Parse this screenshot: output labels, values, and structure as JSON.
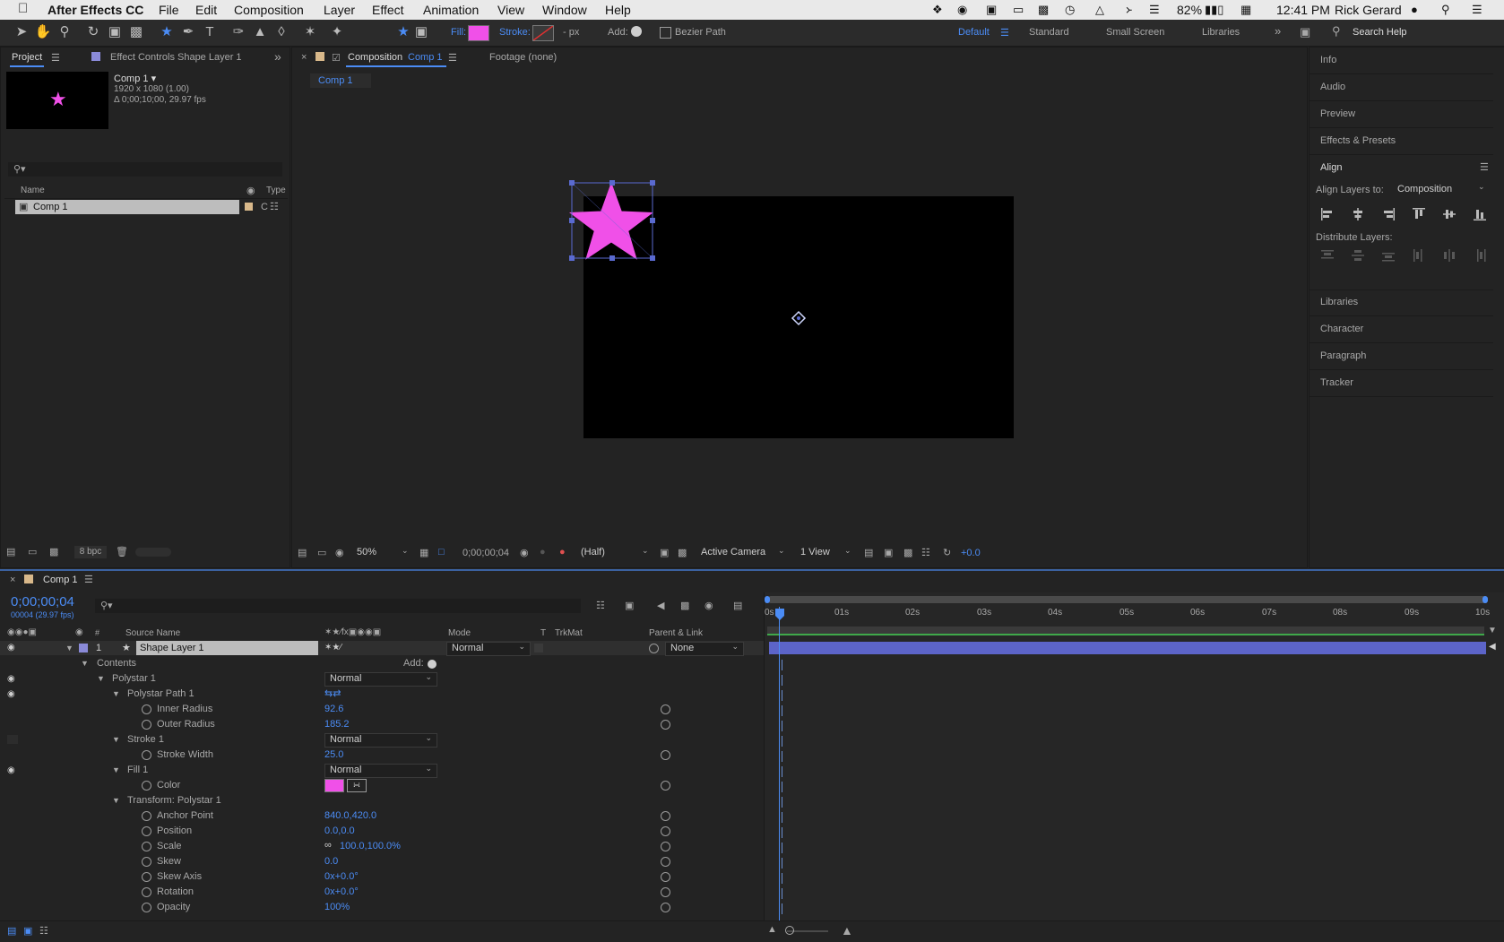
{
  "menubar": {
    "app_name": "After Effects CC",
    "items": [
      "File",
      "Edit",
      "Composition",
      "Layer",
      "Effect",
      "Animation",
      "View",
      "Window",
      "Help"
    ],
    "battery": "82%",
    "time": "12:41 PM",
    "user": "Rick Gerard"
  },
  "toolbar": {
    "fill_label": "Fill:",
    "fill_color": "#f050e8",
    "stroke_label": "Stroke:",
    "stroke_px": "- px",
    "add_label": "Add:",
    "bezier_label": "Bezier Path",
    "workspaces": [
      "Default",
      "Standard",
      "Small Screen",
      "Libraries"
    ],
    "search_help": "Search Help"
  },
  "project": {
    "tab_project": "Project",
    "tab_effect_controls": "Effect Controls Shape Layer 1",
    "comp_name": "Comp 1 ▾",
    "comp_res": "1920 x 1080 (1.00)",
    "comp_dur": "Δ 0;00;10;00, 29.97 fps",
    "col_name": "Name",
    "col_type": "Type",
    "item_name": "Comp 1",
    "item_type": "C",
    "bpc": "8 bpc"
  },
  "viewer": {
    "tab_composition": "Composition",
    "tab_comp_name": "Comp 1",
    "tab_footage": "Footage (none)",
    "breadcrumb": "Comp 1",
    "zoom": "50%",
    "timecode": "0;00;00;04",
    "resolution": "(Half)",
    "camera": "Active Camera",
    "views": "1 View",
    "exposure": "+0.0"
  },
  "right_panels": {
    "items": [
      "Info",
      "Audio",
      "Preview",
      "Effects & Presets"
    ],
    "align_title": "Align",
    "align_layers_to": "Align Layers to:",
    "align_target": "Composition",
    "distribute_layers": "Distribute Layers:",
    "items2": [
      "Libraries",
      "Character",
      "Paragraph",
      "Tracker"
    ]
  },
  "timeline": {
    "tab": "Comp 1",
    "timecode": "0;00;00;04",
    "frame_info": "00004 (29.97 fps)",
    "col_source": "Source Name",
    "col_mode": "Mode",
    "col_t": "T",
    "col_trkmat": "TrkMat",
    "col_parent": "Parent & Link",
    "ruler": [
      "0s",
      "01s",
      "02s",
      "03s",
      "04s",
      "05s",
      "06s",
      "07s",
      "08s",
      "09s",
      "10s"
    ],
    "layer": {
      "num": "1",
      "name": "Shape Layer 1",
      "mode": "Normal",
      "parent": "None"
    },
    "contents_label": "Contents",
    "add_label": "Add:",
    "polystar": "Polystar 1",
    "polystar_mode": "Normal",
    "polystar_path": "Polystar Path 1",
    "inner_radius_label": "Inner Radius",
    "inner_radius": "92.6",
    "outer_radius_label": "Outer Radius",
    "outer_radius": "185.2",
    "stroke": "Stroke 1",
    "stroke_mode": "Normal",
    "stroke_width_label": "Stroke Width",
    "stroke_width": "25.0",
    "fill": "Fill 1",
    "fill_mode": "Normal",
    "color_label": "Color",
    "fill_color": "#f050e8",
    "transform": "Transform: Polystar 1",
    "anchor_label": "Anchor Point",
    "anchor": "840.0,420.0",
    "position_label": "Position",
    "position": "0.0,0.0",
    "scale_label": "Scale",
    "scale": "100.0,100.0%",
    "skew_label": "Skew",
    "skew": "0.0",
    "skew_axis_label": "Skew Axis",
    "skew_axis": "0x+0.0°",
    "rotation_label": "Rotation",
    "rotation": "0x+0.0°",
    "opacity_label": "Opacity",
    "opacity": "100%"
  }
}
